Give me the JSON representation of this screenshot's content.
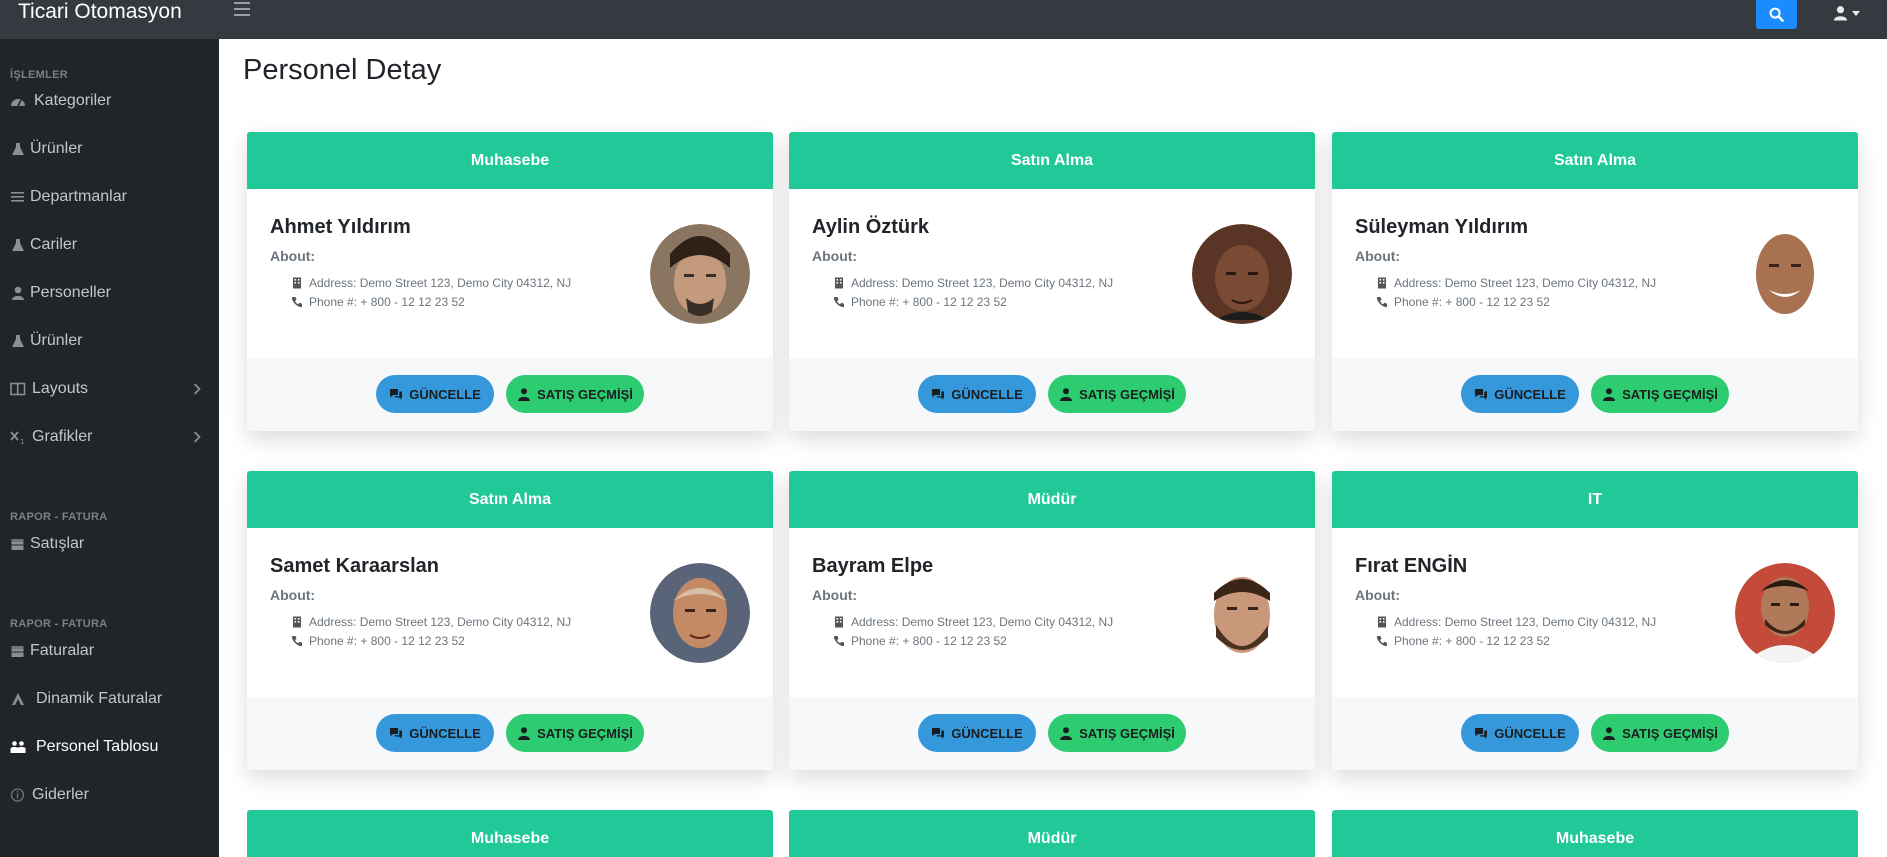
{
  "app": {
    "title": "Ticari Otomasyon"
  },
  "sidebar": {
    "sections": [
      "İŞLEMLER",
      "RAPOR - FATURA",
      "RAPOR - FATURA"
    ],
    "items": [
      {
        "label": "Kategoriler",
        "icon": "dashboard-icon"
      },
      {
        "label": "Ürünler",
        "icon": "flask-icon"
      },
      {
        "label": "Departmanlar",
        "icon": "bars-icon"
      },
      {
        "label": "Cariler",
        "icon": "flask-icon"
      },
      {
        "label": "Personeller",
        "icon": "user-icon"
      },
      {
        "label": "Ürünler",
        "icon": "flask-icon"
      },
      {
        "label": "Layouts",
        "icon": "columns-icon"
      },
      {
        "label": "Grafikler",
        "icon": "subscript-icon"
      },
      {
        "label": "Satışlar",
        "icon": "calendar-icon"
      },
      {
        "label": "Faturalar",
        "icon": "calendar-icon"
      },
      {
        "label": "Dinamik Faturalar",
        "icon": "drafting-icon"
      },
      {
        "label": "Personel Tablosu",
        "icon": "people-icon"
      },
      {
        "label": "Giderler",
        "icon": "info-circle-icon"
      }
    ],
    "active_item": "Personel Tablosu"
  },
  "page": {
    "title": "Personel Detay"
  },
  "card_labels": {
    "about": "About:",
    "address": "Address: Demo Street 123, Demo City 04312, NJ",
    "phone": "Phone #: + 800 - 12 12 23 52",
    "update_button": "GÜNCELLE",
    "history_button": "SATIŞ GEÇMİŞİ"
  },
  "cards": [
    {
      "department": "Muhasebe",
      "name": "Ahmet Yıldırım"
    },
    {
      "department": "Satın Alma",
      "name": "Aylin Öztürk"
    },
    {
      "department": "Satın Alma",
      "name": "Süleyman Yıldırım"
    },
    {
      "department": "Satın Alma",
      "name": "Samet Karaarslan"
    },
    {
      "department": "Müdür",
      "name": "Bayram Elpe"
    },
    {
      "department": "IT",
      "name": "Fırat ENGİN"
    },
    {
      "department": "Muhasebe"
    },
    {
      "department": "Müdür"
    },
    {
      "department": "Muhasebe"
    }
  ],
  "colors": {
    "topbar": "#343a40",
    "sidebar": "#212529",
    "card_header": "#20c997",
    "update_button": "#3498db",
    "history_button": "#2ecc71",
    "search_button": "#1a8cff"
  }
}
